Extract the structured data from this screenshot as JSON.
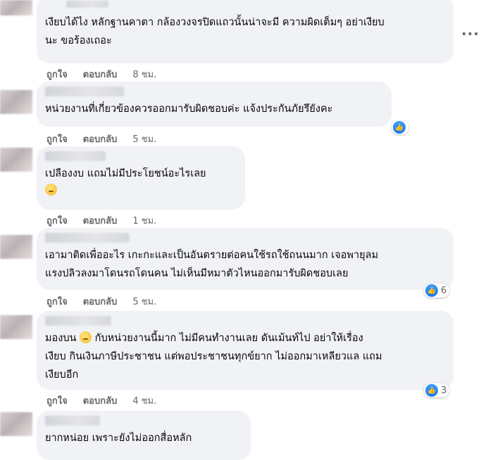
{
  "actions": {
    "like": "ถูกใจ",
    "reply": "ตอบกลับ"
  },
  "comments": [
    {
      "text": "เงียบได้ไง หลักฐานคาตา กล้องวงจรปิดแถวนั้นน่าจะมี ความผิดเต็มๆ อย่าเงียบ\nนะ ขอร้องเถอะ",
      "time": "8 ชม.",
      "reaction_count": ""
    },
    {
      "text": "หน่วยงานที่เกี่ยวข้องควรออกมารับผิดชอบค่ะ แจ้งประกันภัยรึยังคะ",
      "time": "5 ชม.",
      "reaction_count": ""
    },
    {
      "text": "เปลืองงบ แถมไม่มีประโยชน์อะไรเลย",
      "time": "1 ชม.",
      "reaction_count": ""
    },
    {
      "text": "เอามาติดเพื่ออะไร เกะกะและเป็นอันตรายต่อคนใช้รถใช้ถนนมาก เจอพายุลม\nแรงปลิวลงมาโดนรถโดนคน ไม่เห็นมีหมาตัวไหนออกมารับผิดชอบเลย",
      "time": "5 ชม.",
      "reaction_count": "6"
    },
    {
      "text_before": "มองบน",
      "text_after": " กับหน่วยงานนี้มาก ไม่มีคนทำงานเลย ดันเม้นท์ไป อย่าให้เรื่อง\nเงียบ กินเงินภาษีประชาชน แต่พอประชาชนทุกข์ยาก ไม่ออกมาเหลียวแล แถม\nเงียบอีก",
      "time": "4 ชม.",
      "reaction_count": "3"
    },
    {
      "text": "ยากหน่อย เพราะยังไม่ออกสื่อหลัก",
      "time": "",
      "reaction_count": ""
    }
  ],
  "icons": {
    "like_reaction": "thumbs-up-icon",
    "emoji": "rolling-eyes-emoji",
    "more": "more-options-icon"
  },
  "colors": {
    "bubble": "#f0f2f5",
    "meta_text": "#65676b",
    "like_blue": "#1877f2"
  }
}
